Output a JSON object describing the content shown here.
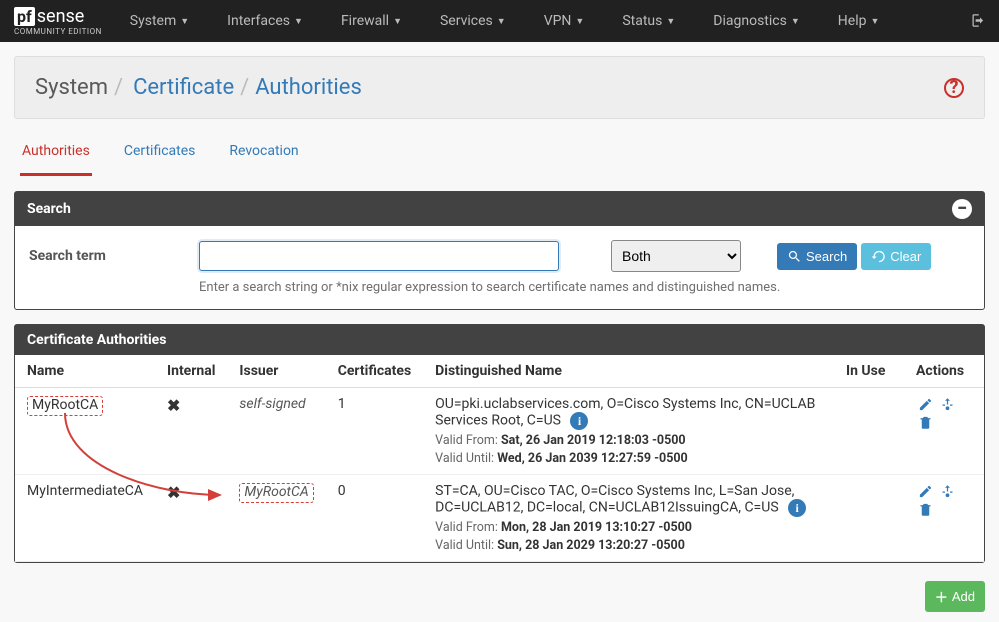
{
  "brand": {
    "pf": "pf",
    "sense": "sense",
    "sub": "COMMUNITY EDITION"
  },
  "nav": {
    "items": [
      {
        "label": "System"
      },
      {
        "label": "Interfaces"
      },
      {
        "label": "Firewall"
      },
      {
        "label": "Services"
      },
      {
        "label": "VPN"
      },
      {
        "label": "Status"
      },
      {
        "label": "Diagnostics"
      },
      {
        "label": "Help"
      }
    ]
  },
  "breadcrumb": {
    "root": "System",
    "mid": "Certificate",
    "leaf": "Authorities",
    "sep": "/"
  },
  "tabs": [
    {
      "label": "Authorities",
      "active": true
    },
    {
      "label": "Certificates",
      "active": false
    },
    {
      "label": "Revocation",
      "active": false
    }
  ],
  "search": {
    "heading": "Search",
    "term_label": "Search term",
    "scope_options": [
      "Both"
    ],
    "scope_selected": "Both",
    "search_btn": "Search",
    "clear_btn": "Clear",
    "hint": "Enter a search string or *nix regular expression to search certificate names and distinguished names."
  },
  "ca_panel": {
    "heading": "Certificate Authorities",
    "columns": {
      "name": "Name",
      "internal": "Internal",
      "issuer": "Issuer",
      "certificates": "Certificates",
      "dn": "Distinguished Name",
      "inuse": "In Use",
      "actions": "Actions"
    },
    "rows": [
      {
        "name": "MyRootCA",
        "internal": true,
        "issuer": "self-signed",
        "certificates": "1",
        "dn": "OU=pki.uclabservices.com, O=Cisco Systems Inc, CN=UCLAB Services Root, C=US",
        "valid_from_label": "Valid From:",
        "valid_from": "Sat, 26 Jan 2019 12:18:03 -0500",
        "valid_until_label": "Valid Until:",
        "valid_until": "Wed, 26 Jan 2039 12:27:59 -0500"
      },
      {
        "name": "MyIntermediateCA",
        "internal": true,
        "issuer": "MyRootCA",
        "certificates": "0",
        "dn": "ST=CA, OU=Cisco TAC, O=Cisco Systems Inc, L=San Jose, DC=UCLAB12, DC=local, CN=UCLAB12IssuingCA, C=US",
        "valid_from_label": "Valid From:",
        "valid_from": "Mon, 28 Jan 2019 13:10:27 -0500",
        "valid_until_label": "Valid Until:",
        "valid_until": "Sun, 28 Jan 2029 13:20:27 -0500"
      }
    ]
  },
  "footer": {
    "add_label": "Add"
  }
}
